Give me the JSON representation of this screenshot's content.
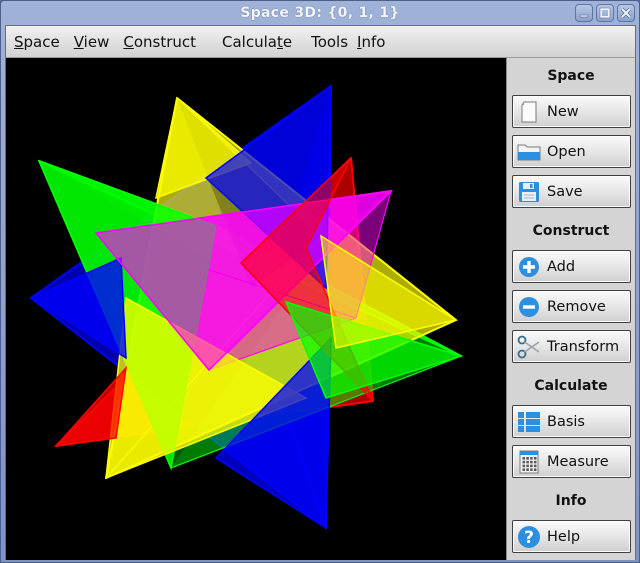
{
  "window": {
    "title": "Space 3D: {0, 1, 1}",
    "controls": [
      "minimize",
      "maximize",
      "close"
    ]
  },
  "menubar": {
    "items": [
      {
        "label": "Space",
        "mnemonic_index": 0
      },
      {
        "label": "View",
        "mnemonic_index": 0
      },
      {
        "label": "Construct",
        "mnemonic_index": 0
      },
      {
        "label": "Calculate",
        "mnemonic_index": 7
      },
      {
        "label": "Tools",
        "mnemonic_index": -1
      },
      {
        "label": "Info",
        "mnemonic_index": 0
      }
    ]
  },
  "viewport": {
    "description": "Compound of five tetrahedra",
    "background": "#000000",
    "tetrahedra": [
      {
        "name": "green",
        "color": "#00ff00"
      },
      {
        "name": "yellow",
        "color": "#ffff00"
      },
      {
        "name": "blue",
        "color": "#0000ff"
      },
      {
        "name": "red",
        "color": "#ff0000"
      },
      {
        "name": "magenta",
        "color": "#ff00ff"
      }
    ]
  },
  "sidebar": {
    "sections": [
      {
        "title": "Space",
        "buttons": [
          {
            "label": "New",
            "icon": "new-document-icon"
          },
          {
            "label": "Open",
            "icon": "open-folder-icon"
          },
          {
            "label": "Save",
            "icon": "save-floppy-icon"
          }
        ]
      },
      {
        "title": "Construct",
        "buttons": [
          {
            "label": "Add",
            "icon": "add-circle-icon"
          },
          {
            "label": "Remove",
            "icon": "remove-circle-icon"
          },
          {
            "label": "Transform",
            "icon": "scissors-icon"
          }
        ]
      },
      {
        "title": "Calculate",
        "buttons": [
          {
            "label": "Basis",
            "icon": "basis-list-icon"
          },
          {
            "label": "Measure",
            "icon": "calculator-icon"
          }
        ]
      },
      {
        "title": "Info",
        "buttons": [
          {
            "label": "Help",
            "icon": "help-icon"
          }
        ]
      }
    ]
  }
}
